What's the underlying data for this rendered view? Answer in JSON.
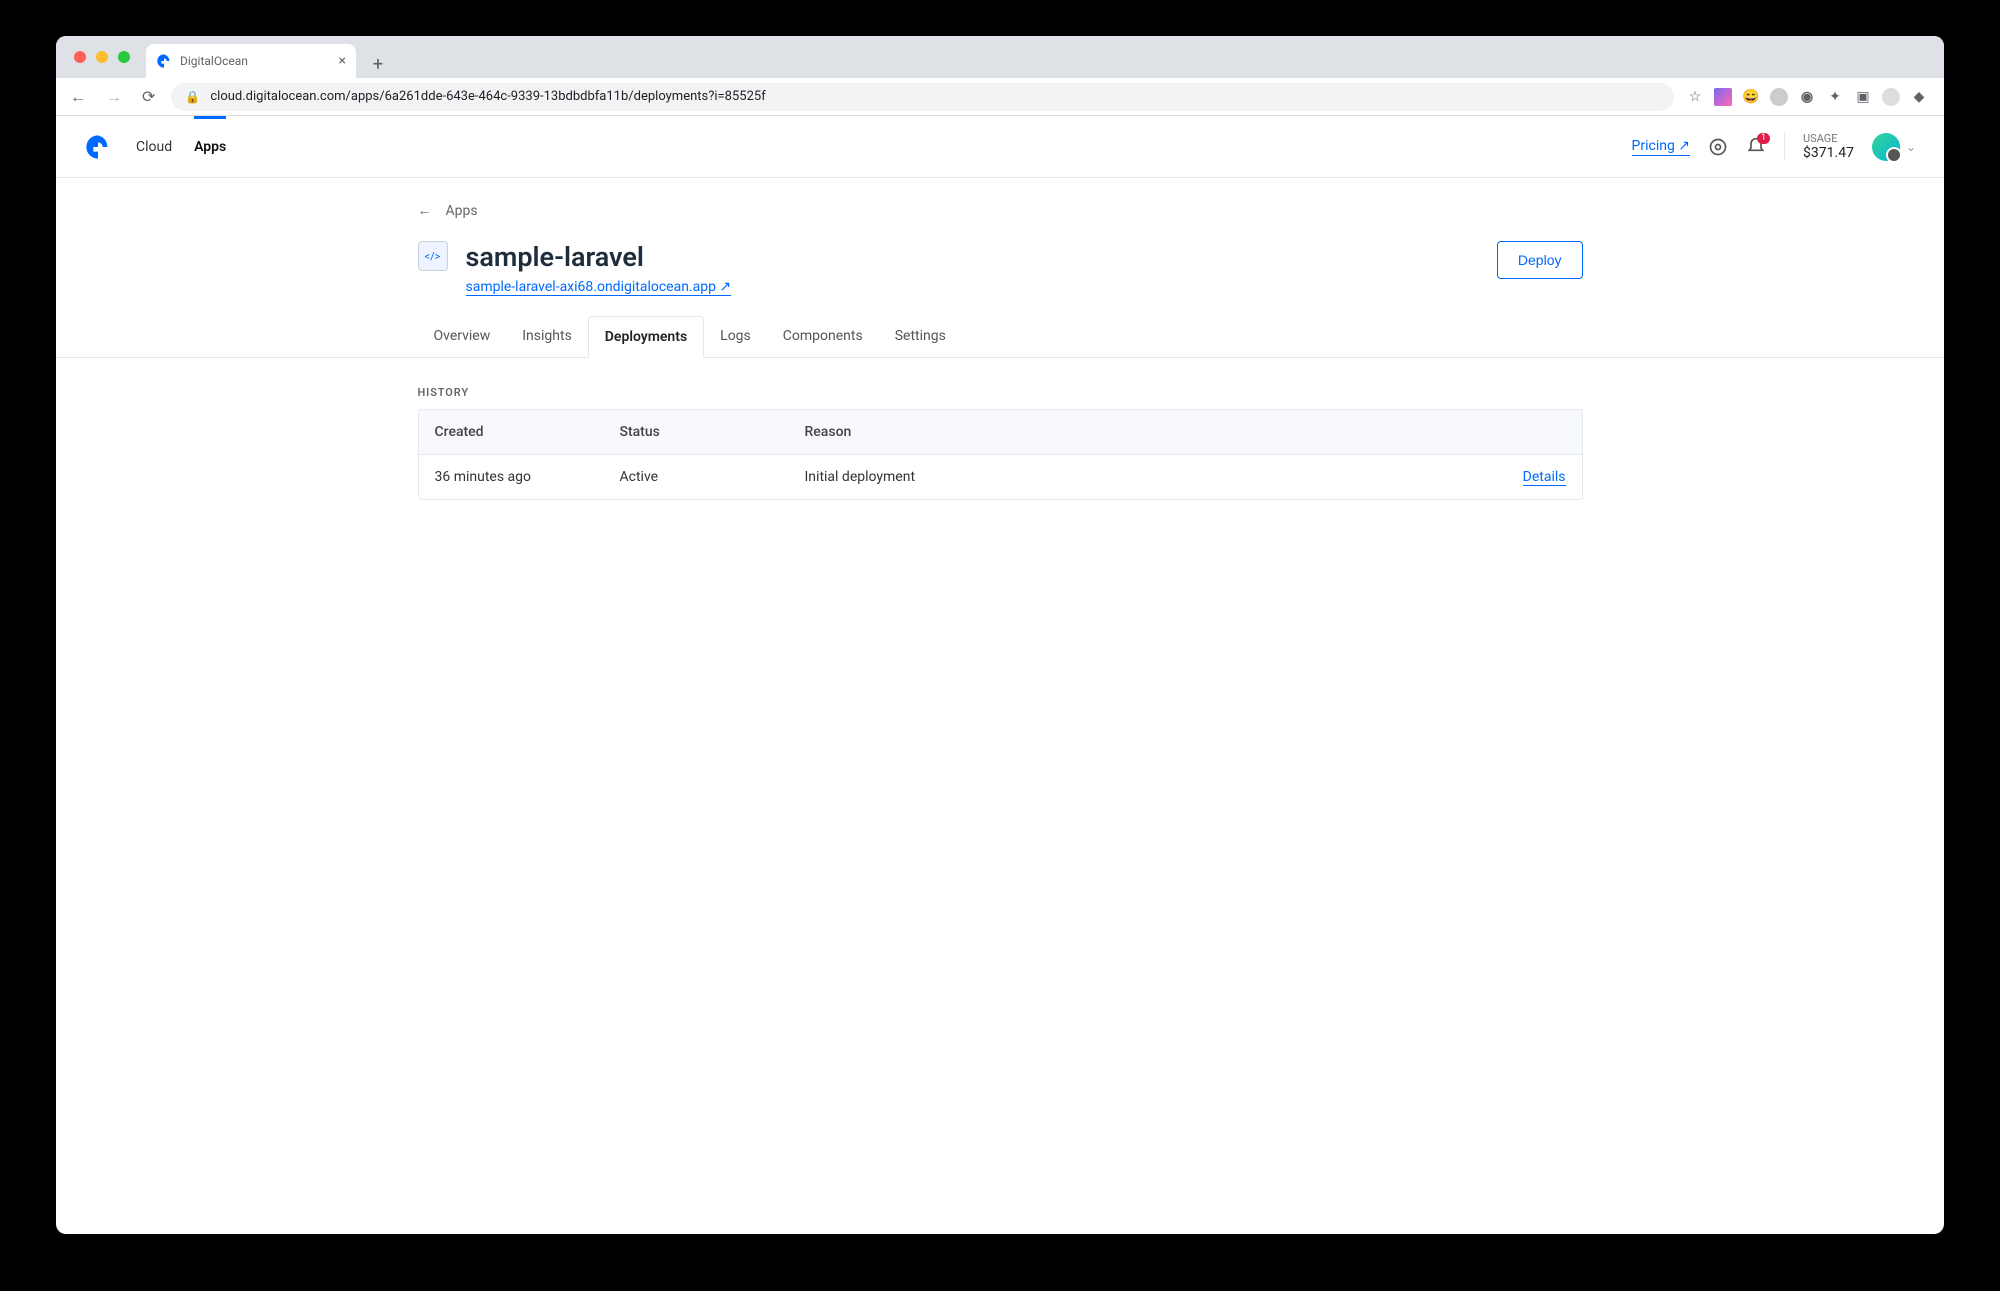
{
  "browser": {
    "tab_title": "DigitalOcean",
    "url": "cloud.digitalocean.com/apps/6a261dde-643e-464c-9339-13bdbdbfa11b/deployments?i=85525f"
  },
  "header": {
    "nav": {
      "cloud": "Cloud",
      "apps": "Apps"
    },
    "pricing": "Pricing ↗",
    "notification_count": "1",
    "usage_label": "USAGE",
    "usage_amount": "$371.47"
  },
  "breadcrumb": {
    "back_label": "Apps"
  },
  "app": {
    "title": "sample-laravel",
    "url": "sample-laravel-axi68.ondigitalocean.app ↗",
    "deploy_button": "Deploy"
  },
  "tabs": {
    "overview": "Overview",
    "insights": "Insights",
    "deployments": "Deployments",
    "logs": "Logs",
    "components": "Components",
    "settings": "Settings"
  },
  "history": {
    "label": "HISTORY",
    "cols": {
      "created": "Created",
      "status": "Status",
      "reason": "Reason"
    },
    "rows": [
      {
        "created": "36 minutes ago",
        "status": "Active",
        "reason": "Initial deployment",
        "details": "Details"
      }
    ]
  }
}
